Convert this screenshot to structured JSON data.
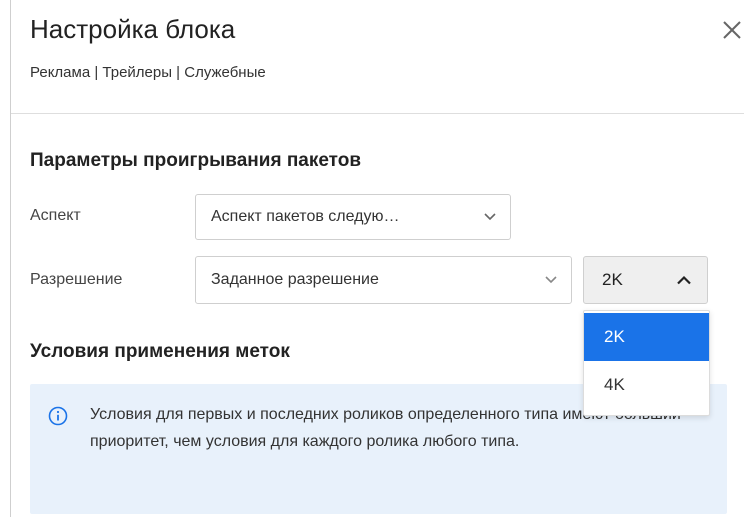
{
  "header": {
    "title": "Настройка блока",
    "subtitle": "Реклама | Трейлеры | Служебные",
    "close_icon": "close-icon"
  },
  "playback": {
    "section_title": "Параметры проигрывания пакетов",
    "aspect": {
      "label": "Аспект",
      "value": "Аспект пакетов следую…"
    },
    "resolution": {
      "label": "Разрешение",
      "mode_value": "Заданное разрешение",
      "size_value": "2K",
      "options": [
        "2K",
        "4K"
      ],
      "selected_option": "2K"
    }
  },
  "marks": {
    "section_title": "Условия применения меток",
    "info_icon": "info-icon",
    "info_text": "Условия для первых и последних роликов определенного типа имеют больший приоритет, чем условия для каждого ролика любого типа."
  },
  "colors": {
    "accent": "#1a73e8",
    "info_background": "#e8f1fb"
  }
}
